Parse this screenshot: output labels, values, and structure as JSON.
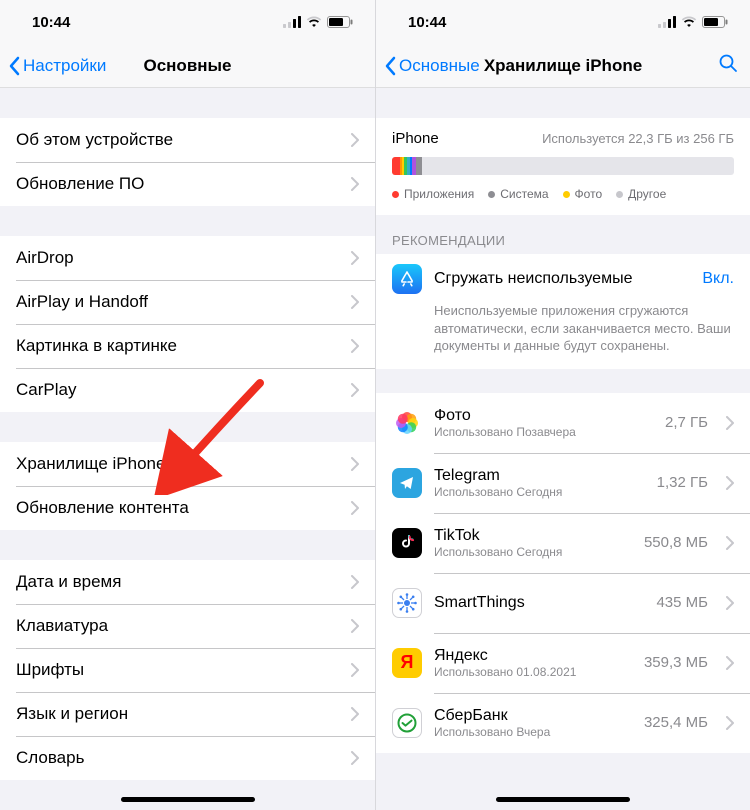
{
  "status": {
    "time": "10:44"
  },
  "left": {
    "back": "Настройки",
    "title": "Основные",
    "groups": [
      {
        "rows": [
          {
            "label": "Об этом устройстве",
            "name": "row-about"
          },
          {
            "label": "Обновление ПО",
            "name": "row-software-update"
          }
        ]
      },
      {
        "rows": [
          {
            "label": "AirDrop",
            "name": "row-airdrop"
          },
          {
            "label": "AirPlay и Handoff",
            "name": "row-airplay-handoff"
          },
          {
            "label": "Картинка в картинке",
            "name": "row-pip"
          },
          {
            "label": "CarPlay",
            "name": "row-carplay"
          }
        ]
      },
      {
        "rows": [
          {
            "label": "Хранилище iPhone",
            "name": "row-iphone-storage"
          },
          {
            "label": "Обновление контента",
            "name": "row-background-refresh"
          }
        ]
      },
      {
        "rows": [
          {
            "label": "Дата и время",
            "name": "row-date-time"
          },
          {
            "label": "Клавиатура",
            "name": "row-keyboard"
          },
          {
            "label": "Шрифты",
            "name": "row-fonts"
          },
          {
            "label": "Язык и регион",
            "name": "row-language-region"
          },
          {
            "label": "Словарь",
            "name": "row-dictionary"
          }
        ]
      }
    ]
  },
  "right": {
    "back": "Основные",
    "title": "Хранилище iPhone",
    "storage": {
      "device": "iPhone",
      "usage": "Используется 22,3 ГБ из 256 ГБ",
      "segments": [
        {
          "color": "#ff3b30",
          "pct": 2.2
        },
        {
          "color": "#ff9500",
          "pct": 0.6
        },
        {
          "color": "#ffcc00",
          "pct": 0.6
        },
        {
          "color": "#34c759",
          "pct": 1.0
        },
        {
          "color": "#30b0c7",
          "pct": 0.8
        },
        {
          "color": "#007aff",
          "pct": 0.7
        },
        {
          "color": "#af52de",
          "pct": 1.2
        },
        {
          "color": "#8e8e93",
          "pct": 1.6
        }
      ],
      "legend": [
        {
          "color": "#ff3b30",
          "label": "Приложения"
        },
        {
          "color": "#8e8e93",
          "label": "Система"
        },
        {
          "color": "#ffcc00",
          "label": "Фото"
        },
        {
          "color": "#c7c7cc",
          "label": "Другое"
        }
      ]
    },
    "reco_header": "РЕКОМЕНДАЦИИ",
    "reco": {
      "title": "Сгружать неиспользуемые",
      "state": "Вкл.",
      "desc": "Неиспользуемые приложения сгружаются автоматически, если заканчивается место. Ваши документы и данные будут сохранены."
    },
    "apps": [
      {
        "name": "Фото",
        "sub": "Использовано Позавчера",
        "size": "2,7 ГБ",
        "icon": "photos"
      },
      {
        "name": "Telegram",
        "sub": "Использовано Сегодня",
        "size": "1,32 ГБ",
        "icon": "telegram"
      },
      {
        "name": "TikTok",
        "sub": "Использовано Сегодня",
        "size": "550,8 МБ",
        "icon": "tiktok"
      },
      {
        "name": "SmartThings",
        "sub": "",
        "size": "435 МБ",
        "icon": "smartthings"
      },
      {
        "name": "Яндекс",
        "sub": "Использовано 01.08.2021",
        "size": "359,3 МБ",
        "icon": "yandex"
      },
      {
        "name": "СберБанк",
        "sub": "Использовано Вчера",
        "size": "325,4 МБ",
        "icon": "sberbank"
      }
    ]
  }
}
